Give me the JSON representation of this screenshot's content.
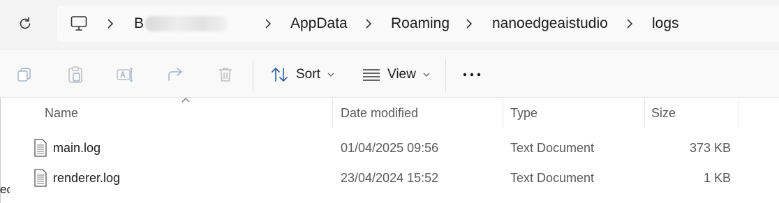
{
  "address_bar": {
    "crumbs": [
      {
        "label": "B"
      },
      {
        "label": "AppData"
      },
      {
        "label": "Roaming"
      },
      {
        "label": "nanoedgeaistudio"
      },
      {
        "label": "logs"
      }
    ],
    "icons": {
      "refresh": "refresh-icon",
      "computer": "computer-icon",
      "separator": "chevron-right-icon"
    }
  },
  "command_bar": {
    "tools": [
      "copy-icon",
      "paste-icon",
      "rename-icon",
      "share-icon",
      "delete-icon"
    ],
    "sort_label": "Sort",
    "view_label": "View",
    "more_label": "•••"
  },
  "columns": {
    "name": "Name",
    "date": "Date modified",
    "type": "Type",
    "size": "Size"
  },
  "files": [
    {
      "name": "main.log",
      "date": "01/04/2025 09:56",
      "type": "Text Document",
      "size": "373 KB"
    },
    {
      "name": "renderer.log",
      "date": "23/04/2024 15:52",
      "type": "Text Document",
      "size": "1 KB"
    }
  ],
  "edge_fragment": "ec"
}
